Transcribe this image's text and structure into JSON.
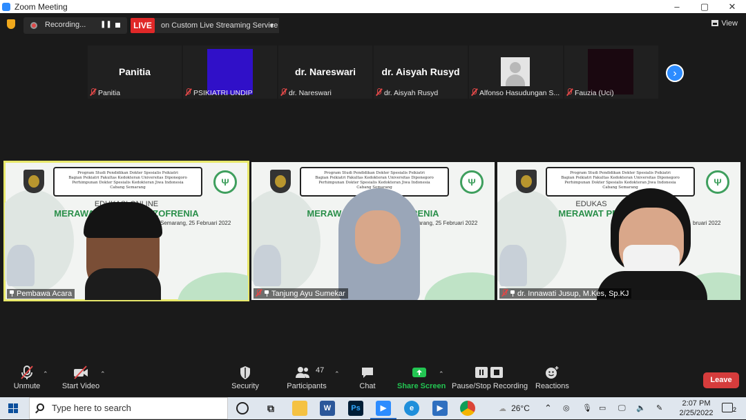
{
  "window": {
    "title": "Zoom Meeting",
    "controls": [
      "–",
      "▢",
      "✕"
    ]
  },
  "topbar": {
    "recording_label": "Recording...",
    "live_label": "LIVE",
    "stream_label": "on Custom Live Streaming Service",
    "view_label": "View"
  },
  "thumbnails": [
    {
      "big_name": "Panitia",
      "name": "Panitia",
      "video": "none"
    },
    {
      "big_name": "",
      "name": "PSIKIATRI UNDIP",
      "video": "blue"
    },
    {
      "big_name": "dr. Nareswari",
      "name": "dr. Nareswari",
      "video": "none"
    },
    {
      "big_name": "dr. Aisyah Rusyd",
      "name": "dr. Aisyah Rusyd",
      "video": "none"
    },
    {
      "big_name": "",
      "name": "Alfonso Hasudungan S...",
      "video": "avatar"
    },
    {
      "big_name": "",
      "name": "Fauzia (Uci)",
      "video": "dark"
    }
  ],
  "slide": {
    "header_lines": [
      "Program Studi Pendidikan Dokter Spesialis Psikiatri",
      "Bagian Psikiatri Fakultas Kedokteran Universitas Diponegoro",
      "Perhimpunan Dokter Spesialis Kedokteran Jiwa Indonesia",
      "Cabang Semarang"
    ]
  },
  "videos": [
    {
      "name": "Pembawa Acara",
      "subtitle": "EDUKASI ONLINE",
      "title": "MERAWAT PEN                AN SKIZOFRENIA",
      "date": "Semarang, 25 Februari 2022",
      "active": true
    },
    {
      "name": "Tanjung Ayu Sumekar",
      "subtitle": "EDU                  LINE",
      "title": "MERAWAT PE                N SKIZOFRENIA",
      "date": "Semarang, 25 Februari 2022",
      "active": false
    },
    {
      "name": "dr. Innawati Jusup, M.Kes, Sp.KJ",
      "subtitle": "EDUKAS",
      "title": "MERAWAT PENDER                FRENIA",
      "date": "bruari 2022",
      "active": false
    }
  ],
  "toolbar": {
    "unmute": "Unmute",
    "start_video": "Start Video",
    "security": "Security",
    "participants": "Participants",
    "participants_count": "47",
    "chat": "Chat",
    "share_screen": "Share Screen",
    "pause_stop_recording": "Pause/Stop Recording",
    "reactions": "Reactions",
    "leave": "Leave"
  },
  "taskbar": {
    "search_placeholder": "Type here to search",
    "weather": "26°C",
    "time": "2:07 PM",
    "date": "2/25/2022",
    "notifications": "2"
  },
  "colors": {
    "zoom_blue": "#2d8cff",
    "live_red": "#e02828",
    "leave_red": "#d63c3c",
    "share_green": "#23c552",
    "active_speaker": "#e8e86a",
    "slide_green": "#2a8f4a"
  }
}
